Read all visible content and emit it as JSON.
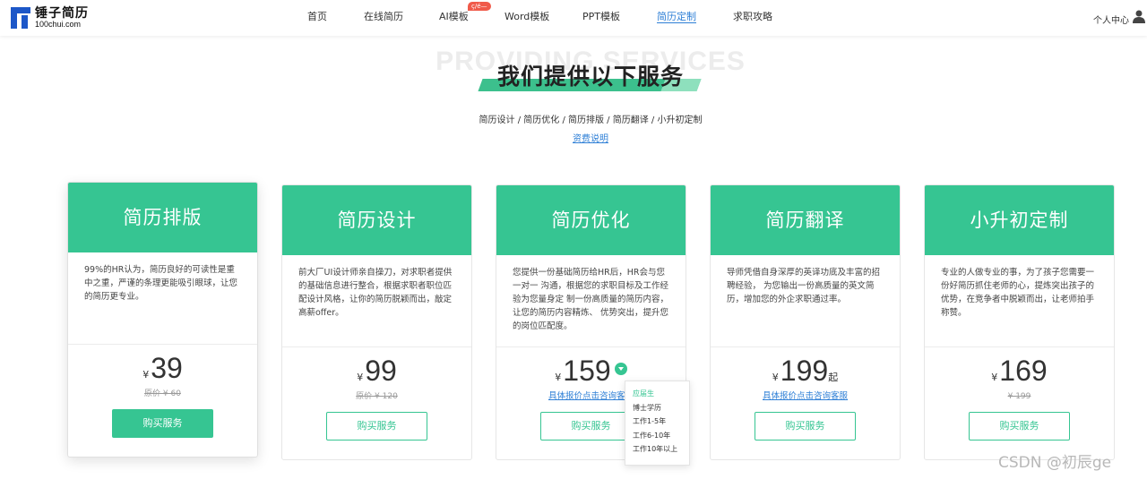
{
  "header": {
    "logo_cn": "锤子简历",
    "logo_en": "100chui.com",
    "nav": [
      {
        "label": "首页",
        "active": false
      },
      {
        "label": "在线简历",
        "active": false
      },
      {
        "label": "AI模板",
        "active": false,
        "badge": "ç/é—"
      },
      {
        "label": "Word模板",
        "active": false
      },
      {
        "label": "PPT模板",
        "active": false
      },
      {
        "label": "简历定制",
        "active": true
      },
      {
        "label": "求职攻略",
        "active": false
      }
    ],
    "user_center": "个人中心"
  },
  "hero": {
    "bg_title": "PROVIDING SERVICES",
    "title": "我们提供以下服务",
    "subtitle": "简历设计 / 简历优化 / 简历排版 / 简历翻译 / 小升初定制",
    "fee_link": "资费说明"
  },
  "cards": [
    {
      "title": "简历排版",
      "desc": "99%的HR认为，简历良好的可读性是重中之重，严谨的条理更能吸引眼球，让您的简历更专业。",
      "currency": "¥",
      "price": "39",
      "suffix": "",
      "original": "原价 ¥ 60",
      "quote": "",
      "button": "购买服务"
    },
    {
      "title": "简历设计",
      "desc": "前大厂UI设计师亲自操刀，对求职者提供的基础信息进行整合，根据求职者职位匹配设计风格，让你的简历脱颖而出，敲定高薪offer。",
      "currency": "¥",
      "price": "99",
      "suffix": "",
      "original": "原价 ¥ 120",
      "quote": "",
      "button": "购买服务"
    },
    {
      "title": "简历优化",
      "desc": "您提供一份基础简历给HR后，HR会与您一对一 沟通，根据您的求职目标及工作经验为您量身定 制一份高质量的简历内容，让您的简历内容精炼、 优势突出，提升您的岗位匹配度。",
      "currency": "¥",
      "price": "159",
      "suffix": "",
      "original": "",
      "quote": "具体报价点击咨询客服",
      "button": "购买服务"
    },
    {
      "title": "简历翻译",
      "desc": "导师凭借自身深厚的英译功底及丰富的招聘经验， 为您输出一份高质量的英文简历，增加您的外企求职通过率。",
      "currency": "¥",
      "price": "199",
      "suffix": "起",
      "original": "",
      "quote": "具体报价点击咨询客服",
      "button": "购买服务"
    },
    {
      "title": "小升初定制",
      "desc": "专业的人做专业的事，为了孩子您需要一份好简历抓住老师的心，提炼突出孩子的优势，在竞争者中脱颖而出，让老师拍手称赞。",
      "currency": "¥",
      "price": "169",
      "suffix": "",
      "original": "¥ 199",
      "quote": "",
      "button": "购买服务"
    }
  ],
  "dropdown": {
    "options": [
      "应届生",
      "博士学历",
      "工作1-5年",
      "工作6-10年",
      "工作10年以上"
    ],
    "selected": "应届生"
  },
  "watermark": "CSDN @初辰ge",
  "colors": {
    "accent": "#36c592",
    "link": "#2e7fd6"
  }
}
